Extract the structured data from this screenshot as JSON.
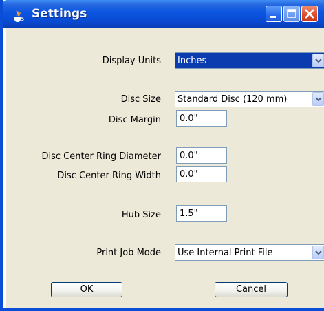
{
  "window": {
    "title": "Settings",
    "icons": {
      "app": "java-cup-icon",
      "minimize": "minimize-icon",
      "maximize": "maximize-icon",
      "close": "close-icon"
    },
    "colors": {
      "titlebar": "#0a4ed8",
      "content_bg": "#ece9d8",
      "selection": "#0a3cb0",
      "close_button": "#dd4a2a"
    }
  },
  "fields": {
    "display_units": {
      "label": "Display Units",
      "value": "Inches"
    },
    "disc_size": {
      "label": "Disc Size",
      "value": "Standard Disc (120 mm)"
    },
    "disc_margin": {
      "label": "Disc Margin",
      "value": "0.0\""
    },
    "center_ring_diameter": {
      "label": "Disc Center Ring Diameter",
      "value": "0.0\""
    },
    "center_ring_width": {
      "label": "Disc Center Ring Width",
      "value": "0.0\""
    },
    "hub_size": {
      "label": "Hub Size",
      "value": "1.5\""
    },
    "print_job_mode": {
      "label": "Print Job Mode",
      "value": "Use Internal Print File"
    }
  },
  "buttons": {
    "ok": "OK",
    "cancel": "Cancel"
  }
}
